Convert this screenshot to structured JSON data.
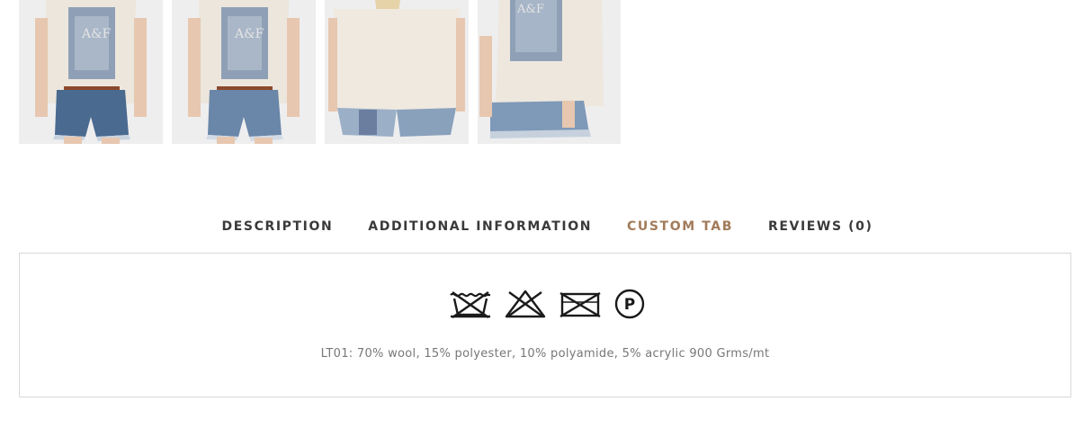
{
  "gallery": {
    "thumbnails": [
      {
        "alt": "front view"
      },
      {
        "alt": "front view"
      },
      {
        "alt": "back view"
      },
      {
        "alt": "side view"
      }
    ]
  },
  "tabs": [
    {
      "label": "DESCRIPTION",
      "active": false
    },
    {
      "label": "ADDITIONAL INFORMATION",
      "active": false
    },
    {
      "label": "CUSTOM TAB",
      "active": true
    },
    {
      "label": "REVIEWS (0)",
      "active": false
    }
  ],
  "custom_tab": {
    "care_icons": [
      "do-not-wash-icon",
      "do-not-bleach-icon",
      "do-not-tumble-dry-icon",
      "dry-clean-p-icon"
    ],
    "dry_clean_letter": "P",
    "composition": "LT01: 70% wool, 15% polyester, 10% polyamide, 5% acrylic 900 Grms/mt"
  },
  "colors": {
    "active_tab": "#a27b5a",
    "tab_text": "#3a3a3a",
    "body_text": "#777777",
    "border": "#d9d9d9"
  }
}
